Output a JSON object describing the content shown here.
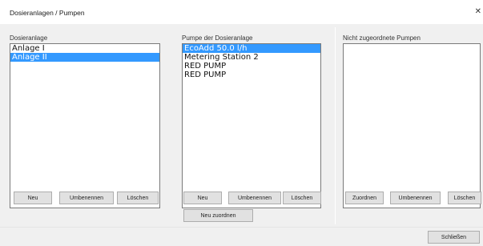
{
  "window": {
    "title": "Dosieranlagen / Pumpen",
    "close_glyph": "✕"
  },
  "dosieranlage": {
    "label": "Dosieranlage",
    "items": [
      {
        "text": "Anlage I",
        "selected": false
      },
      {
        "text": "Anlage II",
        "selected": true
      }
    ],
    "buttons": {
      "new": "Neu",
      "rename": "Umbenennen",
      "delete": "Löschen"
    }
  },
  "pumpen": {
    "label": "Pumpe der Dosieranlage",
    "items": [
      {
        "text": "EcoAdd 50.0 l/h",
        "selected": true
      },
      {
        "text": "Metering Station 2",
        "selected": false
      },
      {
        "text": "RED PUMP",
        "selected": false
      },
      {
        "text": "RED PUMP",
        "selected": false
      }
    ],
    "buttons": {
      "new": "Neu",
      "rename": "Umbenennen",
      "delete": "Löschen",
      "reassign": "Neu zuordnen"
    }
  },
  "nicht_zugeordnet": {
    "label": "Nicht zugeordnete Pumpen",
    "items": [],
    "buttons": {
      "assign": "Zuordnen",
      "rename": "Umbenennen",
      "delete": "Löschen"
    }
  },
  "footer": {
    "close_button": "Schließen"
  }
}
